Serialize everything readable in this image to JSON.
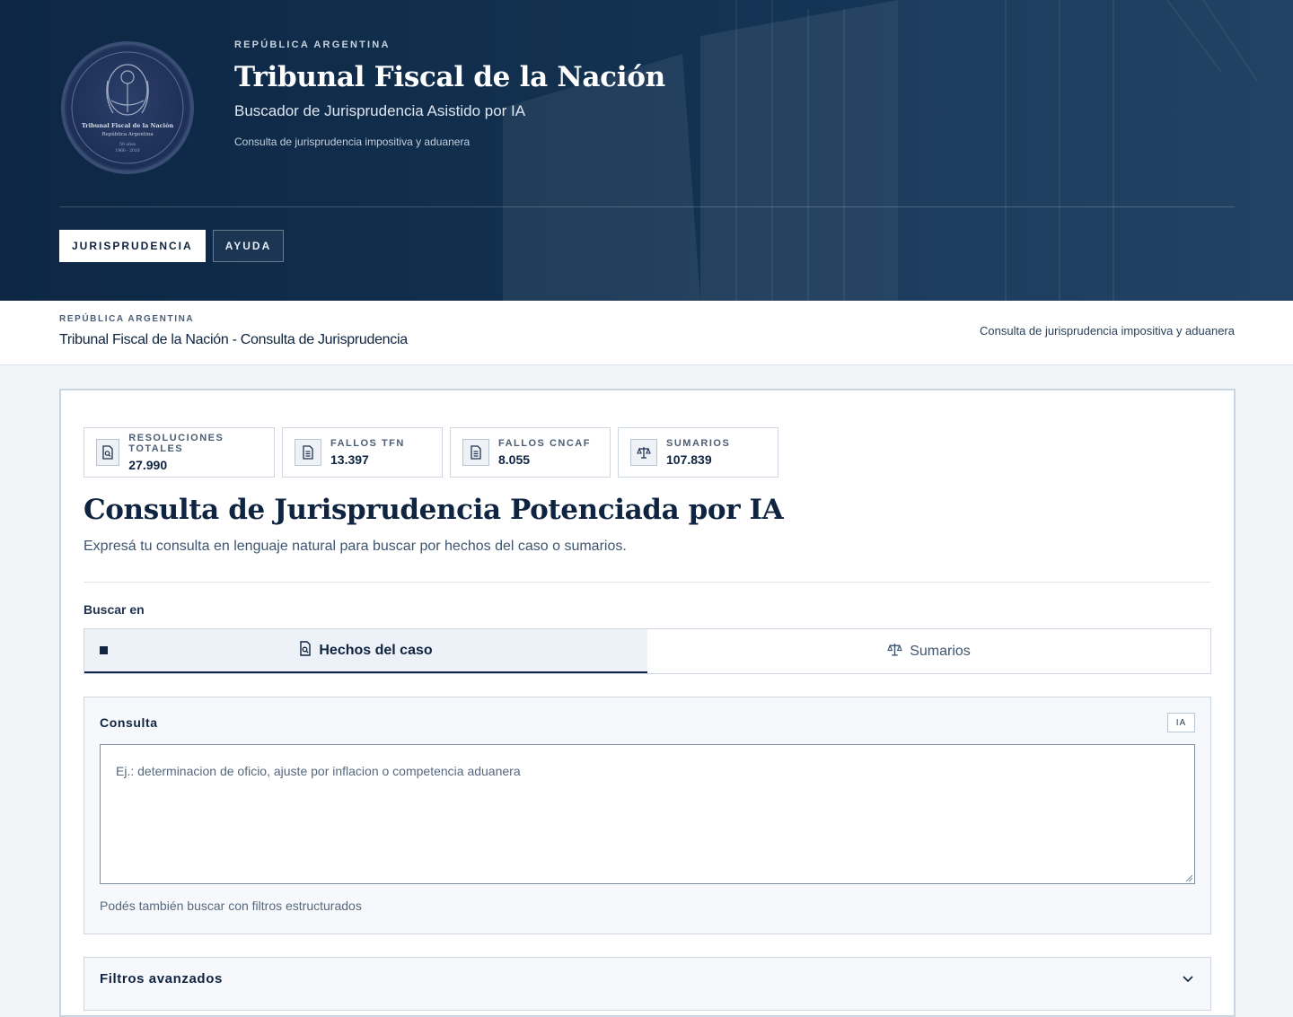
{
  "hero": {
    "eyebrow": "REPÚBLICA ARGENTINA",
    "title": "Tribunal Fiscal de la Nación",
    "subtitle": "Buscador de Jurisprudencia Asistido por IA",
    "tagline": "Consulta de jurisprudencia impositiva y aduanera",
    "seal": {
      "line1": "Tribunal Fiscal de la Nación",
      "line2": "República Argentina",
      "line3": "50 años",
      "line4": "1960 - 2010"
    },
    "nav": [
      {
        "label": "JURISPRUDENCIA",
        "active": true
      },
      {
        "label": "AYUDA",
        "active": false
      }
    ]
  },
  "subheader": {
    "eyebrow": "REPÚBLICA ARGENTINA",
    "title": "Tribunal Fiscal de la Nación - Consulta de Jurisprudencia",
    "right_text": "Consulta de jurisprudencia impositiva y aduanera"
  },
  "stats": [
    {
      "label": "RESOLUCIONES TOTALES",
      "value": "27.990",
      "icon": "document-search-icon"
    },
    {
      "label": "FALLOS TFN",
      "value": "13.397",
      "icon": "document-icon"
    },
    {
      "label": "FALLOS CNCAF",
      "value": "8.055",
      "icon": "document-icon"
    },
    {
      "label": "SUMARIOS",
      "value": "107.839",
      "icon": "scales-icon"
    }
  ],
  "main": {
    "title": "Consulta de Jurisprudencia Potenciada por IA",
    "description": "Expresá tu consulta en lenguaje natural para buscar por hechos del caso o sumarios.",
    "search_in_label": "Buscar en"
  },
  "tabs": [
    {
      "label": "Hechos del caso",
      "active": true,
      "icon": "document-search-icon"
    },
    {
      "label": "Sumarios",
      "active": false,
      "icon": "scales-icon"
    }
  ],
  "query": {
    "label": "Consulta",
    "badge": "IA",
    "placeholder": "Ej.: determinacion de oficio, ajuste por inflacion o competencia aduanera",
    "value": "",
    "hint": "Podés también buscar con filtros estructurados"
  },
  "filters": {
    "label": "Filtros avanzados",
    "expanded": false
  },
  "colors": {
    "navy": "#0f2440",
    "hero_bg": "#12304f",
    "muted": "#3f5570",
    "border": "#cfd8e2"
  }
}
